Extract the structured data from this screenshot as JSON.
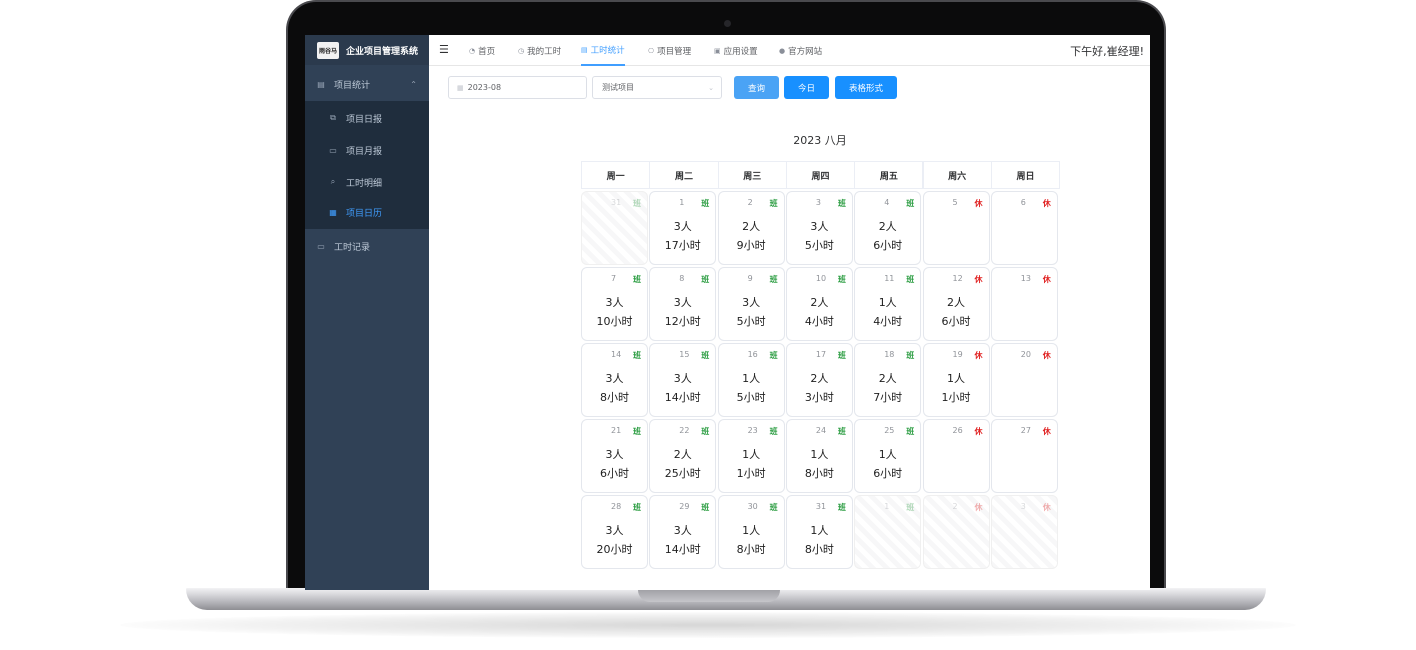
{
  "sidebar": {
    "logo_text": "雨谷马",
    "title": "企业项目管理系统",
    "group": {
      "label": "项目统计",
      "icon": "document-icon"
    },
    "items": [
      {
        "label": "项目日报",
        "icon": "copy-icon"
      },
      {
        "label": "项目月报",
        "icon": "monitor-icon"
      },
      {
        "label": "工时明细",
        "icon": "search-doc-icon"
      },
      {
        "label": "项目日历",
        "icon": "calendar-icon"
      }
    ],
    "bottom": {
      "label": "工时记录",
      "icon": "screen-icon"
    }
  },
  "header": {
    "tabs": [
      {
        "label": "首页",
        "icon": "dashboard-icon"
      },
      {
        "label": "我的工时",
        "icon": "clock-icon"
      },
      {
        "label": "工时统计",
        "icon": "stats-icon"
      },
      {
        "label": "项目管理",
        "icon": "project-icon"
      },
      {
        "label": "应用设置",
        "icon": "settings-icon"
      },
      {
        "label": "官方网站",
        "icon": "globe-icon"
      }
    ],
    "active_tab": "工时统计",
    "greeting": "下午好,崔经理!"
  },
  "toolbar": {
    "month_value": "2023-08",
    "project_value": "测试项目",
    "query_label": "查询",
    "today_label": "今日",
    "table_label": "表格形式"
  },
  "calendar": {
    "title": "2023 八月",
    "weekdays": [
      "周一",
      "周二",
      "周三",
      "周四",
      "周五",
      "周六",
      "周日"
    ],
    "weeks": [
      [
        {
          "day": "31",
          "tag": "班",
          "out": true
        },
        {
          "day": "1",
          "tag": "班",
          "people": "3人",
          "hours": "17小时"
        },
        {
          "day": "2",
          "tag": "班",
          "people": "2人",
          "hours": "9小时"
        },
        {
          "day": "3",
          "tag": "班",
          "people": "3人",
          "hours": "5小时"
        },
        {
          "day": "4",
          "tag": "班",
          "people": "2人",
          "hours": "6小时"
        },
        {
          "day": "5",
          "tag": "休"
        },
        {
          "day": "6",
          "tag": "休"
        }
      ],
      [
        {
          "day": "7",
          "tag": "班",
          "people": "3人",
          "hours": "10小时"
        },
        {
          "day": "8",
          "tag": "班",
          "people": "3人",
          "hours": "12小时"
        },
        {
          "day": "9",
          "tag": "班",
          "people": "3人",
          "hours": "5小时"
        },
        {
          "day": "10",
          "tag": "班",
          "people": "2人",
          "hours": "4小时"
        },
        {
          "day": "11",
          "tag": "班",
          "people": "1人",
          "hours": "4小时"
        },
        {
          "day": "12",
          "tag": "休",
          "people": "2人",
          "hours": "6小时"
        },
        {
          "day": "13",
          "tag": "休"
        }
      ],
      [
        {
          "day": "14",
          "tag": "班",
          "people": "3人",
          "hours": "8小时"
        },
        {
          "day": "15",
          "tag": "班",
          "people": "3人",
          "hours": "14小时"
        },
        {
          "day": "16",
          "tag": "班",
          "people": "1人",
          "hours": "5小时"
        },
        {
          "day": "17",
          "tag": "班",
          "people": "2人",
          "hours": "3小时"
        },
        {
          "day": "18",
          "tag": "班",
          "people": "2人",
          "hours": "7小时"
        },
        {
          "day": "19",
          "tag": "休",
          "people": "1人",
          "hours": "1小时"
        },
        {
          "day": "20",
          "tag": "休"
        }
      ],
      [
        {
          "day": "21",
          "tag": "班",
          "people": "3人",
          "hours": "6小时"
        },
        {
          "day": "22",
          "tag": "班",
          "people": "2人",
          "hours": "25小时"
        },
        {
          "day": "23",
          "tag": "班",
          "people": "1人",
          "hours": "1小时"
        },
        {
          "day": "24",
          "tag": "班",
          "people": "1人",
          "hours": "8小时"
        },
        {
          "day": "25",
          "tag": "班",
          "people": "1人",
          "hours": "6小时"
        },
        {
          "day": "26",
          "tag": "休"
        },
        {
          "day": "27",
          "tag": "休"
        }
      ],
      [
        {
          "day": "28",
          "tag": "班",
          "people": "3人",
          "hours": "20小时"
        },
        {
          "day": "29",
          "tag": "班",
          "people": "3人",
          "hours": "14小时"
        },
        {
          "day": "30",
          "tag": "班",
          "people": "1人",
          "hours": "8小时"
        },
        {
          "day": "31",
          "tag": "班",
          "people": "1人",
          "hours": "8小时"
        },
        {
          "day": "1",
          "tag": "班",
          "out": true
        },
        {
          "day": "2",
          "tag": "休",
          "out": true
        },
        {
          "day": "3",
          "tag": "休",
          "out": true
        }
      ]
    ]
  },
  "colors": {
    "sidebar_bg": "#304156",
    "submenu_bg": "#1f2d3d",
    "accent": "#409eff",
    "button": "#1890ff",
    "work_tag": "#2e9e44",
    "rest_tag": "#e02020"
  }
}
